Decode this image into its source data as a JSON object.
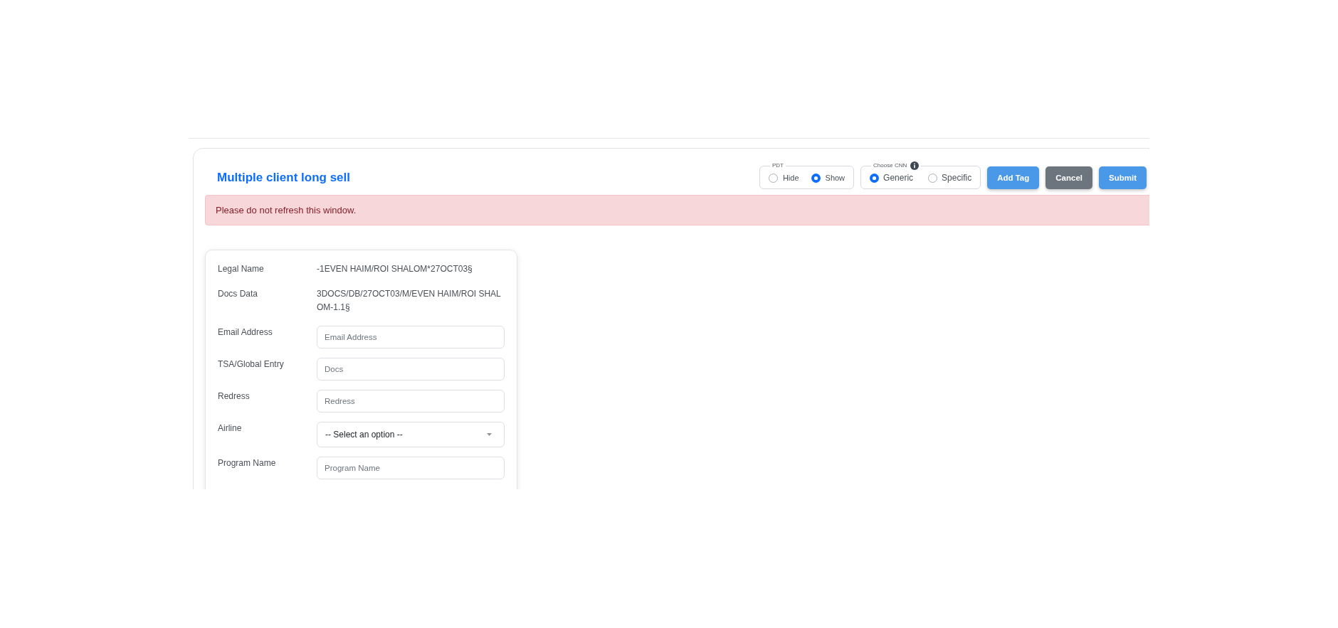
{
  "header": {
    "title": "Multiple client long sell",
    "radio_groups": [
      {
        "legend": "PDT",
        "info": false,
        "options": [
          {
            "label": "Hide",
            "selected": false
          },
          {
            "label": "Show",
            "selected": true
          }
        ]
      },
      {
        "legend": "Choose CNN",
        "info": true,
        "options": [
          {
            "label": "Generic",
            "selected": true
          },
          {
            "label": "Specific",
            "selected": false
          }
        ]
      }
    ],
    "buttons": [
      {
        "label": "Add Tag",
        "kind": "primary"
      },
      {
        "label": "Cancel",
        "kind": "secondary"
      },
      {
        "label": "Submit",
        "kind": "primary"
      }
    ]
  },
  "alert": {
    "text": "Please do not refresh this window."
  },
  "client_card": {
    "rows": [
      {
        "kind": "text",
        "label": "Legal Name",
        "value": "-1EVEN HAIM/ROI SHALOM*27OCT03§"
      },
      {
        "kind": "text",
        "label": "Docs Data",
        "value": "3DOCS/DB/27OCT03/M/EVEN HAIM/ROI SHALOM-1.1§"
      },
      {
        "kind": "input",
        "label": "Email Address",
        "placeholder": "Email Address"
      },
      {
        "kind": "input",
        "label": "TSA/Global Entry",
        "placeholder": "Docs"
      },
      {
        "kind": "input",
        "label": "Redress",
        "placeholder": "Redress"
      },
      {
        "kind": "select",
        "label": "Airline",
        "value": "-- Select an option --"
      },
      {
        "kind": "input",
        "label": "Program Name",
        "placeholder": "Program Name"
      }
    ]
  }
}
